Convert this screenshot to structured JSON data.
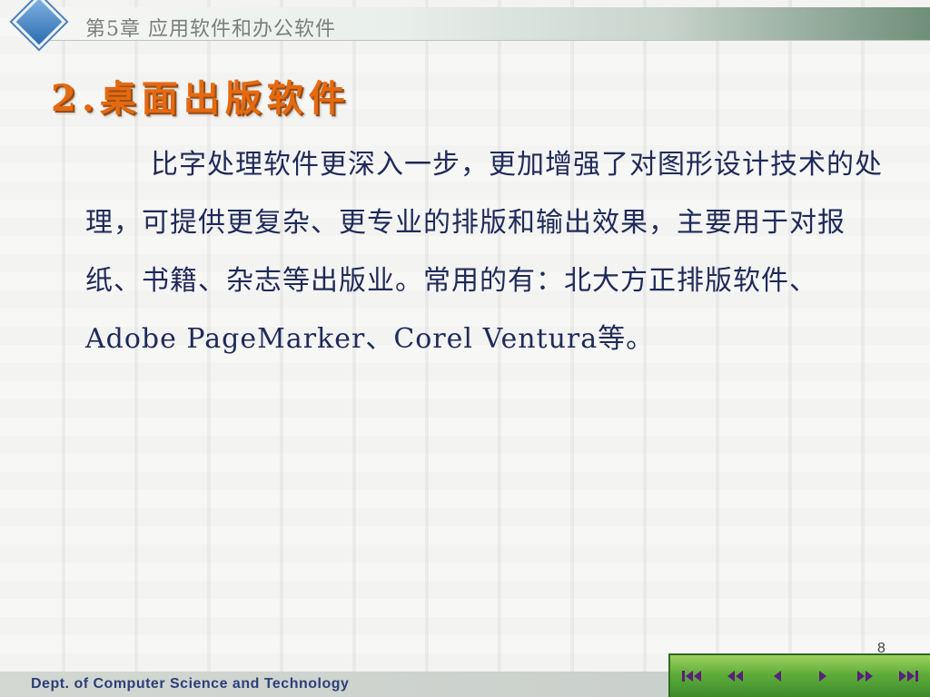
{
  "header": {
    "chapter_title": "第5章  应用软件和办公软件"
  },
  "slide": {
    "heading": "2.桌面出版软件",
    "paragraph": "比字处理软件更深入一步，更加增强了对图形设计技术的处理，可提供更复杂、更专业的排版和输出效果，主要用于对报纸、书籍、杂志等出版业。常用的有：北大方正排版软件、Adobe PageMarker、Corel Ventura等。",
    "page_number": "8"
  },
  "footer": {
    "department": "Dept. of Computer Science and Technology"
  },
  "nav": {
    "buttons": [
      "first-slide",
      "previous-section",
      "previous-slide",
      "next-slide",
      "next-section",
      "last-slide"
    ]
  },
  "colors": {
    "heading": "#e46a12",
    "body_text": "#1f2a5a",
    "footer_text": "#2c3f7a",
    "nav_green": "#5fae3a",
    "nav_icon": "#5a1f7a"
  }
}
